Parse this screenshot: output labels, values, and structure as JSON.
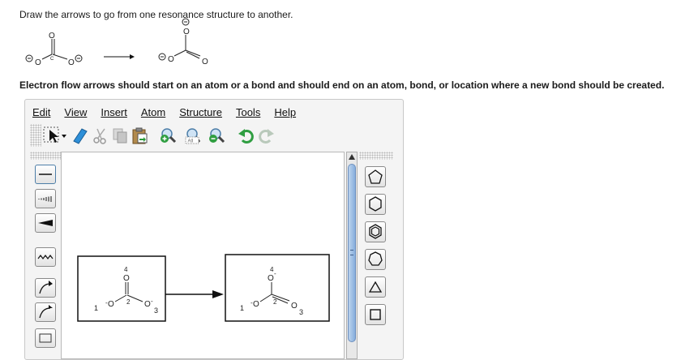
{
  "question": "Draw the arrows to go from one resonance structure to another.",
  "hint": "Electron flow arrows should start on an atom or a bond and should end on an atom, bond, or location where a new bond should be created.",
  "reaction": {
    "left": {
      "atom_top": "O",
      "atom_left": "O",
      "atom_right": "O",
      "carbon": "C",
      "charge_left": "−",
      "charge_right": "−"
    },
    "right": {
      "atom_top": "O",
      "atom_left": "O",
      "atom_right": "O",
      "carbon": "C",
      "charge_top": "−",
      "charge_left": "−"
    }
  },
  "menu": [
    "Edit",
    "View",
    "Insert",
    "Atom",
    "Structure",
    "Tools",
    "Help"
  ],
  "toolbar_icons": [
    "select-tool-icon",
    "eraser-icon",
    "cut-icon",
    "copy-icon",
    "paste-icon",
    "zoom-in-icon",
    "zoom-all-icon",
    "zoom-out-icon",
    "undo-icon",
    "redo-icon"
  ],
  "toolbar_text": {
    "zoom_all": "All"
  },
  "left_tools": [
    "single-bond-icon",
    "hashed-bond-icon",
    "wedge-bond-icon",
    "wavy-bond-icon",
    "electron-pair-arrow-icon",
    "single-electron-arrow-icon",
    "rectangle-tool-icon"
  ],
  "right_tools": [
    "cyclopentane-icon",
    "cyclohexane-icon",
    "benzene-icon",
    "cycloheptane-icon",
    "cyclopropane-icon",
    "cyclobutane-icon"
  ],
  "canvas": {
    "left": {
      "top_num": "4",
      "top_atom": "O",
      "left_num": "1",
      "left_atom": "O",
      "right_atom": "O",
      "right_num": "3",
      "center_num": "2",
      "charge_left": "-",
      "charge_right": "-"
    },
    "right": {
      "top_num": "4",
      "top_atom": "O",
      "left_num": "1",
      "left_atom": "O",
      "right_atom": "O",
      "right_num": "3",
      "center_num": "2",
      "charge_top": "-",
      "charge_left": "-"
    }
  }
}
